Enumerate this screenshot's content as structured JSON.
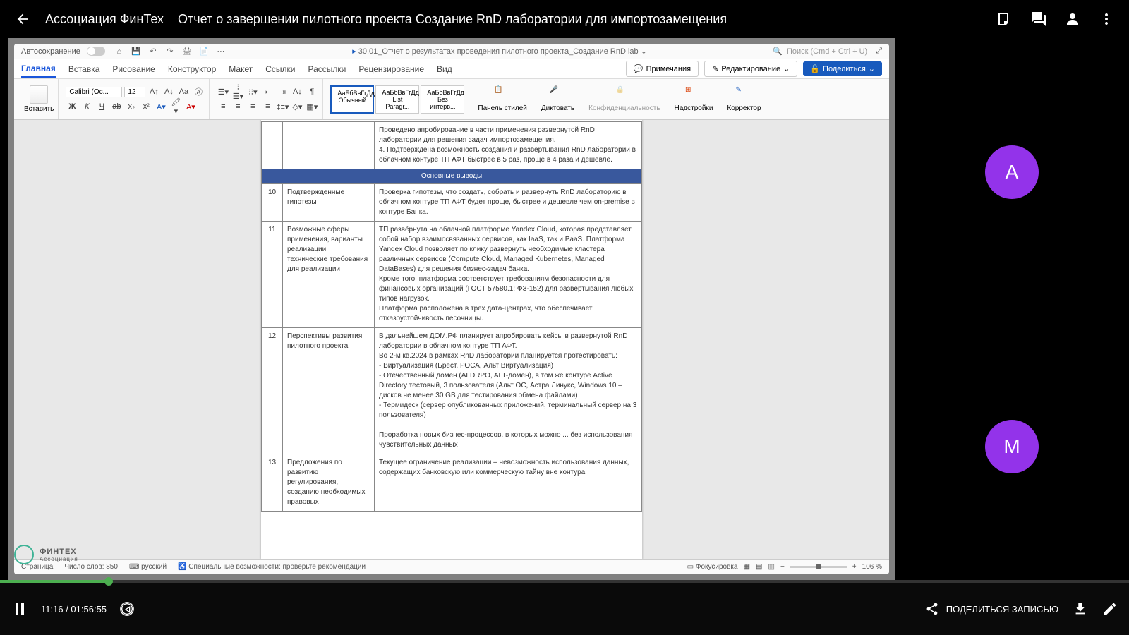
{
  "header": {
    "org": "Ассоциация ФинТех",
    "title": "Отчет о завершении пилотного проекта Создание RnD лаборатории для импортозамещения"
  },
  "doc_app": {
    "autosave": "Автосохранение",
    "doc_name": "30.01_Отчет о результатах проведения пилотного проекта_Создание RnD lab",
    "search_placeholder": "Поиск (Cmd + Ctrl + U)",
    "tabs": [
      "Главная",
      "Вставка",
      "Рисование",
      "Конструктор",
      "Макет",
      "Ссылки",
      "Рассылки",
      "Рецензирование",
      "Вид"
    ],
    "ribbon_right": {
      "notes": "Примечания",
      "edit": "Редактирование",
      "share": "Поделиться"
    },
    "font": {
      "name": "Calibri (Ос...",
      "size": "12"
    },
    "paste": "Вставить",
    "styles": [
      {
        "sample": "АаБбВвГгДд",
        "name": "Обычный"
      },
      {
        "sample": "АаБбВвГгДд",
        "name": "List Paragr..."
      },
      {
        "sample": "АаБбВвГгДд",
        "name": "Без интерв..."
      }
    ],
    "big_buttons": {
      "panel": "Панель стилей",
      "dictate": "Диктовать",
      "confidential": "Конфиденциальность",
      "addins": "Надстройки",
      "corrector": "Корректор"
    },
    "status": {
      "page": "Страница",
      "words": "Число слов: 850",
      "lang": "русский",
      "access": "Специальные возможности: проверьте рекомендации",
      "focus": "Фокусировка",
      "zoom": "106 %"
    }
  },
  "table": {
    "top_cell": "Проведено апробирование в части применения развернутой RnD лаборатории для решения задач импортозамещения.\n4. Подтверждена возможность создания и развертывания RnD лаборатории в облачном контуре ТП АФТ быстрее в 5 раз, проще в 4 раза и дешевле.",
    "header": "Основные выводы",
    "rows": [
      {
        "n": "10",
        "name": "Подтвержденные гипотезы",
        "text": "Проверка гипотезы, что создать, собрать и развернуть RnD лабораторию в облачном контуре ТП АФТ будет проще, быстрее и дешевле чем on-premise в контуре Банка."
      },
      {
        "n": "11",
        "name": "Возможные сферы применения, варианты реализации, технические требования для реализации",
        "text": "ТП развёрнута на облачной платформе Yandex Cloud, которая представляет собой набор взаимосвязанных сервисов, как IaaS, так и PaaS. Платформа Yandex Cloud позволяет по клику развернуть необходимые кластера различных сервисов (Compute Cloud, Managed Kubernetes, Managed DataBases) для решения бизнес-задач банка.\nКроме того, платформа соответствует требованиям безопасности для финансовых организаций (ГОСТ 57580.1; ФЗ-152) для развёртывания любых типов нагрузок.\nПлатформа расположена в трех дата-центрах, что обеспечивает отказоустойчивость песочницы."
      },
      {
        "n": "12",
        "name": "Перспективы развития пилотного проекта",
        "text": "В дальнейшем ДОМ.РФ планирует апробировать кейсы в развернутой RnD лаборатории в облачном контуре ТП АФТ.\nВо 2-м кв.2024 в рамках RnD лаборатории планируется протестировать:\n- Виртуализация (Брест, РОСА, Альт Виртуализация)\n- Отечественный домен (ALDRPO, ALT-домен), в том же контуре Active Directory тестовый, 3 пользователя (Альт ОС, Астра Линукс, Windows 10 – дисков не менее 30 GB для тестирования обмена файлами)\n- Термидеск (сервер опубликованных приложений, терминальный сервер на 3 пользователя)\n\nПроработка новых бизнес-процессов, в которых можно ... без использования чувствительных данных"
      },
      {
        "n": "13",
        "name": "Предложения по развитию регулирования, созданию необходимых правовых",
        "text": "Текущее ограничение реализации – невозможность использования данных, содержащих банковскую или коммерческую тайну вне контура"
      }
    ]
  },
  "participants": [
    {
      "initial": "А"
    },
    {
      "initial": "М"
    }
  ],
  "watermark": {
    "brand": "ФИНТЕХ",
    "sub": "Ассоциация"
  },
  "player": {
    "current": "11:16",
    "total": "01:56:55",
    "share": "ПОДЕЛИТЬСЯ ЗАПИСЬЮ"
  }
}
